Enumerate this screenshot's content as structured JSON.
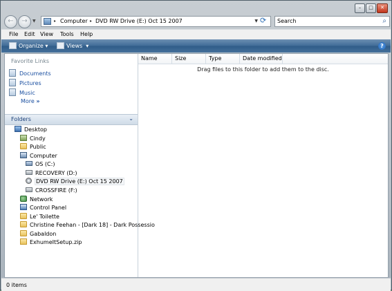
{
  "titlebar": {
    "minimize_icon": "minimize-icon",
    "maximize_icon": "maximize-icon",
    "close_icon": "close-icon"
  },
  "address": {
    "segments": [
      "Computer",
      "DVD RW Drive (E:) Oct 15 2007"
    ]
  },
  "search": {
    "placeholder": "Search"
  },
  "menu": [
    "File",
    "Edit",
    "View",
    "Tools",
    "Help"
  ],
  "commands": {
    "organize": "Organize",
    "views": "Views"
  },
  "favorites": {
    "title": "Favorite Links",
    "items": [
      "Documents",
      "Pictures",
      "Music"
    ],
    "more": "More"
  },
  "folders": {
    "title": "Folders",
    "tree": [
      {
        "label": "Desktop",
        "icon": "desktop"
      },
      {
        "label": "Cindy",
        "icon": "user"
      },
      {
        "label": "Public",
        "icon": "folder"
      },
      {
        "label": "Computer",
        "icon": "computer"
      },
      {
        "label": "OS (C:)",
        "icon": "os-drive"
      },
      {
        "label": "RECOVERY (D:)",
        "icon": "drive"
      },
      {
        "label": "DVD RW Drive (E:) Oct 15 2007",
        "icon": "dvd",
        "selected": true
      },
      {
        "label": "CROSSFIRE (F:)",
        "icon": "drive"
      },
      {
        "label": "Network",
        "icon": "network"
      },
      {
        "label": "Control Panel",
        "icon": "control-panel"
      },
      {
        "label": "Le' Toilette",
        "icon": "folder"
      },
      {
        "label": "Christine Feehan - [Dark 18] - Dark Possessio",
        "icon": "folder"
      },
      {
        "label": "Gabaldon",
        "icon": "folder"
      },
      {
        "label": "ExhumeItSetup.zip",
        "icon": "zip"
      }
    ]
  },
  "columns": [
    "Name",
    "Size",
    "Type",
    "Date modified"
  ],
  "empty_message": "Drag files to this folder to add them to the disc.",
  "status": "0 items"
}
